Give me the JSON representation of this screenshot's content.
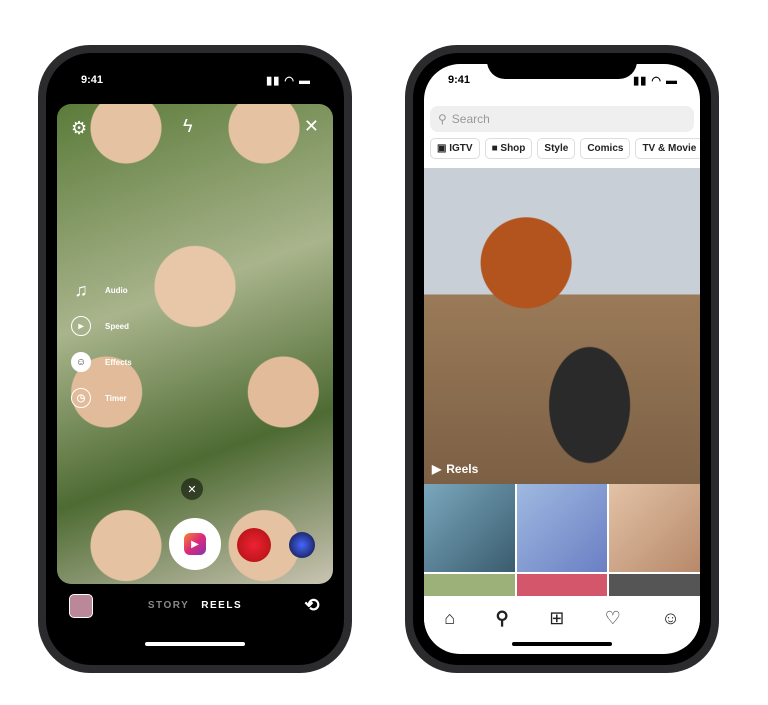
{
  "left_phone": {
    "time": "9:41",
    "tools": [
      {
        "label": "Audio",
        "icon": "music-note-icon"
      },
      {
        "label": "Speed",
        "icon": "speed-icon"
      },
      {
        "label": "Effects",
        "icon": "effects-icon"
      },
      {
        "label": "Timer",
        "icon": "timer-icon"
      }
    ],
    "modes": [
      "STORY",
      "REELS"
    ],
    "active_mode": "REELS"
  },
  "right_phone": {
    "time": "9:41",
    "search_placeholder": "Search",
    "chips": [
      "IGTV",
      "Shop",
      "Style",
      "Comics",
      "TV & Movie"
    ],
    "reels_label": "Reels",
    "nav": [
      "home-icon",
      "search-icon",
      "add-icon",
      "heart-icon",
      "profile-icon"
    ]
  },
  "colors": {
    "accent_gradient_start": "#f58529",
    "accent_gradient_end": "#8134af"
  }
}
